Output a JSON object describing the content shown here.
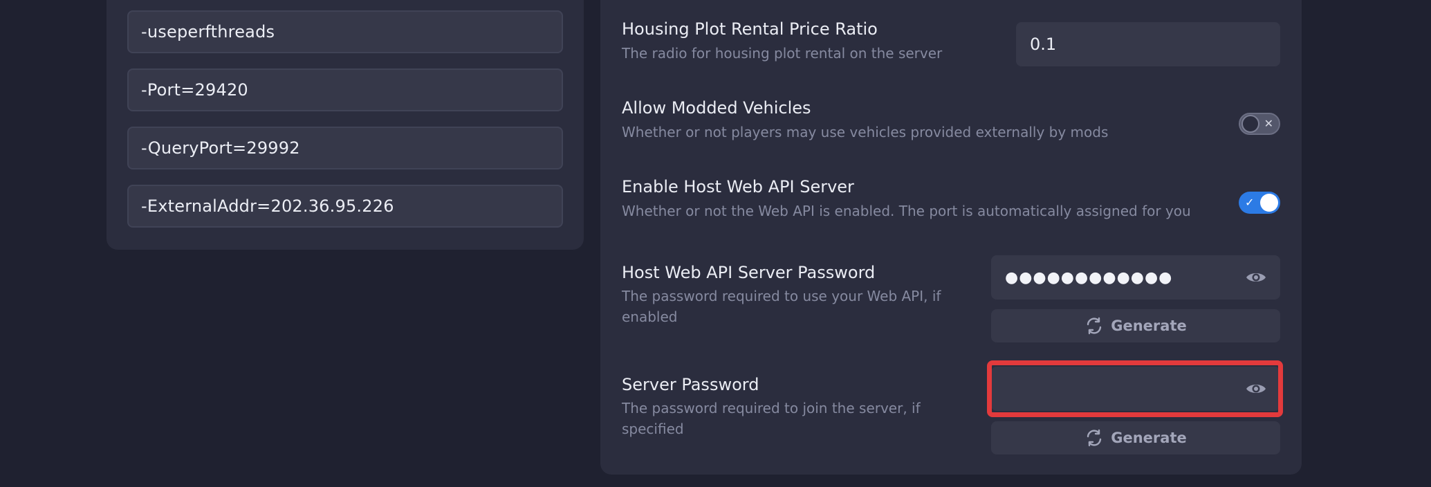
{
  "left_panel": {
    "args": [
      "-useperfthreads",
      "-Port=29420",
      "-QueryPort=29992",
      "-ExternalAddr=202.36.95.226"
    ]
  },
  "settings": {
    "housing": {
      "title": "Housing Plot Rental Price Ratio",
      "desc": "The radio for housing plot rental on the server",
      "value": "0.1"
    },
    "modded_vehicles": {
      "title": "Allow Modded Vehicles",
      "desc": "Whether or not players may use vehicles provided externally by mods",
      "enabled": false
    },
    "web_api": {
      "title": "Enable Host Web API Server",
      "desc": "Whether or not the Web API is enabled. The port is automatically assigned for you",
      "enabled": true
    },
    "web_api_password": {
      "title": "Host Web API Server Password",
      "desc": "The password required to use your Web API, if enabled",
      "value": "●●●●●●●●●●●●",
      "generate_label": "Generate"
    },
    "server_password": {
      "title": "Server Password",
      "desc": "The password required to join the server, if specified",
      "value": "",
      "generate_label": "Generate"
    }
  },
  "colors": {
    "background": "#1f2130",
    "card": "#2b2d3e",
    "field": "#363849",
    "accent": "#2c7be5",
    "highlight": "#e33a3c"
  },
  "icons": {
    "toggle_off_mark": "✕",
    "toggle_on_mark": "✓"
  }
}
